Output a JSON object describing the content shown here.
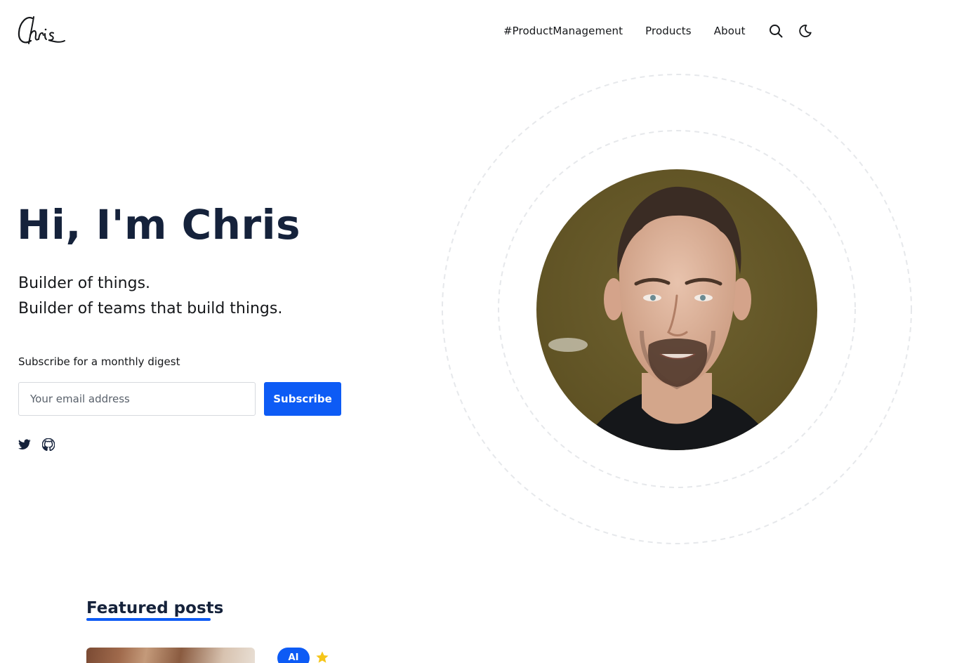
{
  "header": {
    "logo_text": "Chris",
    "nav": [
      {
        "label": "#ProductManagement"
      },
      {
        "label": "Products"
      },
      {
        "label": "About"
      }
    ],
    "icons": [
      "search-icon",
      "moon-icon"
    ]
  },
  "hero": {
    "title": "Hi, I'm Chris",
    "tagline_line1": "Builder of things.",
    "tagline_line2": "Builder of teams that build things.",
    "subscribe_label": "Subscribe for a monthly digest",
    "email_placeholder": "Your email address",
    "subscribe_button": "Subscribe",
    "social_icons": [
      "twitter-icon",
      "github-icon"
    ]
  },
  "featured": {
    "heading": "Featured posts",
    "first_post": {
      "tag": "AI",
      "featured_icon": "star-icon"
    }
  },
  "colors": {
    "accent": "#0d5bf5",
    "heading": "#15223b",
    "text": "#15171a",
    "star": "#f5c518"
  }
}
